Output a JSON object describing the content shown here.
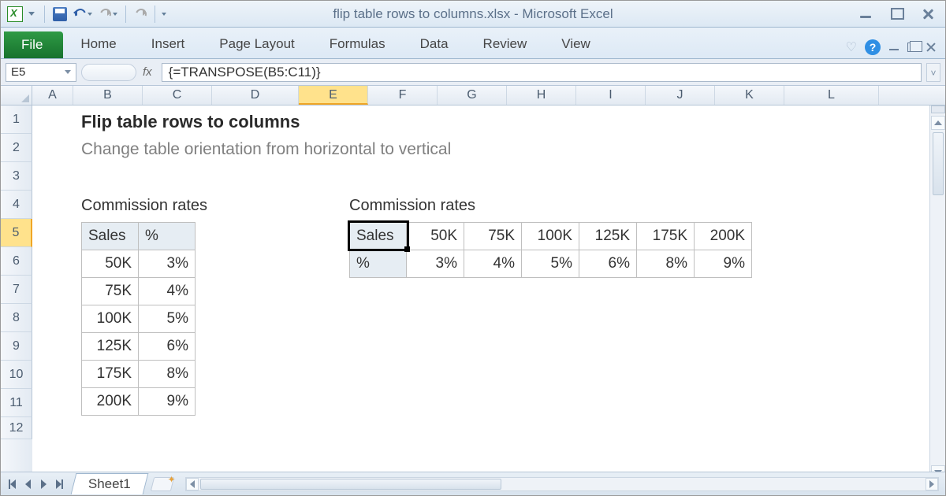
{
  "window_title": "flip table rows to columns.xlsx - Microsoft Excel",
  "ribbon": {
    "file": "File",
    "tabs": [
      "Home",
      "Insert",
      "Page Layout",
      "Formulas",
      "Data",
      "Review",
      "View"
    ]
  },
  "name_box": "E5",
  "fx_label": "fx",
  "formula": "{=TRANSPOSE(B5:C11)}",
  "columns": [
    "A",
    "B",
    "C",
    "D",
    "E",
    "F",
    "G",
    "H",
    "I",
    "J",
    "K",
    "L"
  ],
  "active_col": "E",
  "rows": [
    "1",
    "2",
    "3",
    "4",
    "5",
    "6",
    "7",
    "8",
    "9",
    "10",
    "11",
    "12"
  ],
  "active_row": "5",
  "content": {
    "heading": "Flip table rows to columns",
    "subheading": "Change table orientation from horizontal to vertical",
    "left_label": "Commission rates",
    "right_label": "Commission rates",
    "source": {
      "h1": "Sales",
      "h2": "%",
      "rows": [
        {
          "sales": "50K",
          "pct": "3%"
        },
        {
          "sales": "75K",
          "pct": "4%"
        },
        {
          "sales": "100K",
          "pct": "5%"
        },
        {
          "sales": "125K",
          "pct": "6%"
        },
        {
          "sales": "175K",
          "pct": "8%"
        },
        {
          "sales": "200K",
          "pct": "9%"
        }
      ]
    },
    "result": {
      "r1": [
        "Sales",
        "50K",
        "75K",
        "100K",
        "125K",
        "175K",
        "200K"
      ],
      "r2": [
        "%",
        "3%",
        "4%",
        "5%",
        "6%",
        "8%",
        "9%"
      ]
    }
  },
  "sheet_tab": "Sheet1"
}
